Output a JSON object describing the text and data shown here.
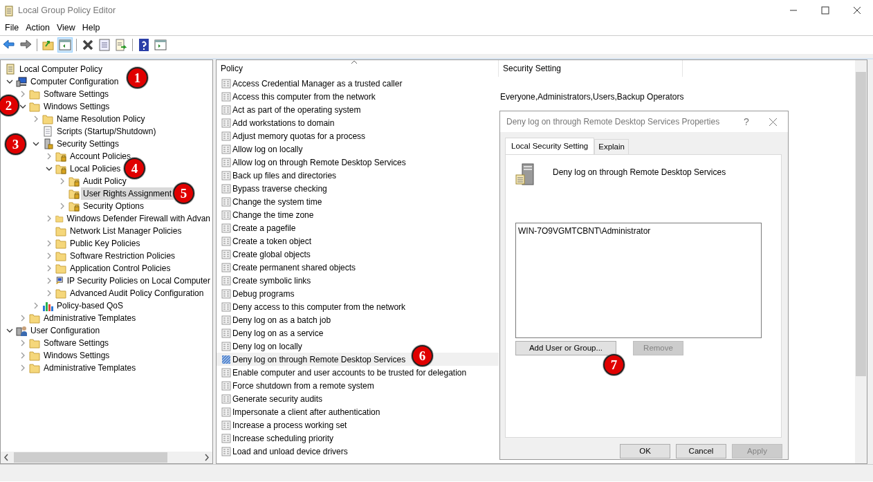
{
  "window": {
    "title": "Local Group Policy Editor"
  },
  "menu": [
    "File",
    "Action",
    "View",
    "Help"
  ],
  "toolbar": [
    {
      "kind": "back",
      "selected": false
    },
    {
      "kind": "forward",
      "selected": false
    },
    {
      "kind": "up",
      "selected": false
    },
    {
      "kind": "tree",
      "selected": true
    },
    {
      "kind": "delete",
      "selected": false
    },
    {
      "kind": "properties",
      "selected": false
    },
    {
      "kind": "export",
      "selected": false
    },
    {
      "kind": "help",
      "selected": false
    },
    {
      "kind": "pane",
      "selected": false
    }
  ],
  "tree": [
    {
      "label": "Local Computer Policy",
      "kind": "policy",
      "selected": false,
      "children": [
        {
          "label": "Computer Configuration",
          "kind": "computer",
          "expanded": true,
          "selected": false,
          "children": [
            {
              "label": "Software Settings",
              "kind": "folder",
              "expanded": false,
              "selected": false
            },
            {
              "label": "Windows Settings",
              "kind": "folder",
              "expanded": true,
              "selected": false,
              "children": [
                {
                  "label": "Name Resolution Policy",
                  "kind": "folder",
                  "expanded": false,
                  "selected": false
                },
                {
                  "label": "Scripts (Startup/Shutdown)",
                  "kind": "script",
                  "selected": false
                },
                {
                  "label": "Security Settings",
                  "kind": "security",
                  "expanded": true,
                  "selected": false,
                  "children": [
                    {
                      "label": "Account Policies",
                      "kind": "lockfolder",
                      "expanded": false,
                      "selected": false
                    },
                    {
                      "label": "Local Policies",
                      "kind": "lockfolder",
                      "expanded": true,
                      "selected": false,
                      "children": [
                        {
                          "label": "Audit Policy",
                          "kind": "lockfolder",
                          "expanded": false,
                          "selected": false
                        },
                        {
                          "label": "User Rights Assignment",
                          "kind": "lockfolder",
                          "selected": true
                        },
                        {
                          "label": "Security Options",
                          "kind": "lockfolder",
                          "expanded": false,
                          "selected": false
                        }
                      ]
                    },
                    {
                      "label": "Windows Defender Firewall with Advan",
                      "kind": "folder",
                      "expanded": false,
                      "selected": false
                    },
                    {
                      "label": "Network List Manager Policies",
                      "kind": "folder",
                      "selected": false
                    },
                    {
                      "label": "Public Key Policies",
                      "kind": "folder",
                      "expanded": false,
                      "selected": false
                    },
                    {
                      "label": "Software Restriction Policies",
                      "kind": "folder",
                      "expanded": false,
                      "selected": false
                    },
                    {
                      "label": "Application Control Policies",
                      "kind": "folder",
                      "expanded": false,
                      "selected": false
                    },
                    {
                      "label": "IP Security Policies on Local Computer",
                      "kind": "ipsec",
                      "expanded": false,
                      "selected": false
                    },
                    {
                      "label": "Advanced Audit Policy Configuration",
                      "kind": "folder",
                      "expanded": false,
                      "selected": false
                    }
                  ]
                },
                {
                  "label": "Policy-based QoS",
                  "kind": "qos",
                  "expanded": false,
                  "selected": false
                }
              ]
            },
            {
              "label": "Administrative Templates",
              "kind": "folder",
              "expanded": false,
              "selected": false
            }
          ]
        },
        {
          "label": "User Configuration",
          "kind": "user",
          "expanded": true,
          "selected": false,
          "children": [
            {
              "label": "Software Settings",
              "kind": "folder",
              "expanded": false,
              "selected": false
            },
            {
              "label": "Windows Settings",
              "kind": "folder",
              "expanded": false,
              "selected": false
            },
            {
              "label": "Administrative Templates",
              "kind": "folder",
              "expanded": false,
              "selected": false
            }
          ]
        }
      ]
    }
  ],
  "table": {
    "columns": [
      "Policy",
      "Security Setting"
    ],
    "rows": [
      {
        "policy": "Access Credential Manager as a trusted caller",
        "selected": false
      },
      {
        "policy": "Access this computer from the network",
        "setting": "Everyone,Administrators,Users,Backup Operators",
        "selected": false
      },
      {
        "policy": "Act as part of the operating system",
        "selected": false
      },
      {
        "policy": "Add workstations to domain",
        "selected": false
      },
      {
        "policy": "Adjust memory quotas for a process",
        "selected": false
      },
      {
        "policy": "Allow log on locally",
        "selected": false
      },
      {
        "policy": "Allow log on through Remote Desktop Services",
        "selected": false
      },
      {
        "policy": "Back up files and directories",
        "selected": false
      },
      {
        "policy": "Bypass traverse checking",
        "selected": false
      },
      {
        "policy": "Change the system time",
        "selected": false
      },
      {
        "policy": "Change the time zone",
        "selected": false
      },
      {
        "policy": "Create a pagefile",
        "selected": false
      },
      {
        "policy": "Create a token object",
        "selected": false
      },
      {
        "policy": "Create global objects",
        "selected": false
      },
      {
        "policy": "Create permanent shared objects",
        "selected": false
      },
      {
        "policy": "Create symbolic links",
        "selected": false
      },
      {
        "policy": "Debug programs",
        "selected": false
      },
      {
        "policy": "Deny access to this computer from the network",
        "selected": false
      },
      {
        "policy": "Deny log on as a batch job",
        "selected": false
      },
      {
        "policy": "Deny log on as a service",
        "selected": false
      },
      {
        "policy": "Deny log on locally",
        "selected": false
      },
      {
        "policy": "Deny log on through Remote Desktop Services",
        "selected": true
      },
      {
        "policy": "Enable computer and user accounts to be trusted for delegation",
        "selected": false
      },
      {
        "policy": "Force shutdown from a remote system",
        "selected": false
      },
      {
        "policy": "Generate security audits",
        "selected": false
      },
      {
        "policy": "Impersonate a client after authentication",
        "selected": false
      },
      {
        "policy": "Increase a process working set",
        "selected": false
      },
      {
        "policy": "Increase scheduling priority",
        "selected": false
      },
      {
        "policy": "Load and unload device drivers",
        "selected": false
      }
    ]
  },
  "dialog": {
    "title": "Deny log on through Remote Desktop Services Properties",
    "help": "?",
    "tabs": [
      {
        "label": "Local Security Setting",
        "selected": true
      },
      {
        "label": "Explain",
        "selected": false
      }
    ],
    "heading": "Deny log on through Remote Desktop Services",
    "members": [
      "WIN-7O9VGMTCBNT\\Administrator"
    ],
    "list_buttons": [
      {
        "label": "Add User or Group...",
        "disabled": false
      },
      {
        "label": "Remove",
        "disabled": true
      }
    ],
    "buttons": [
      {
        "label": "OK",
        "disabled": false
      },
      {
        "label": "Cancel",
        "disabled": false
      },
      {
        "label": "Apply",
        "disabled": true
      }
    ]
  },
  "callouts": [
    "1",
    "2",
    "3",
    "4",
    "5",
    "6",
    "7"
  ]
}
